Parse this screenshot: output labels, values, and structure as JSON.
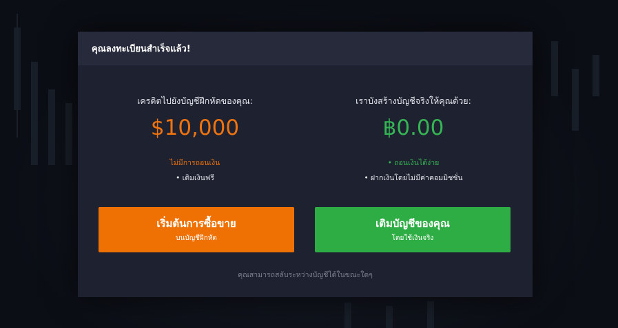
{
  "modal": {
    "title": "คุณลงทะเบียนสำเร็จแล้ว!",
    "demo": {
      "label": "เครดิตไปยังบัญชีฝึกหัดของคุณ:",
      "amount": "$10,000",
      "note_colored": "ไม่มีการถอนเงิน",
      "note_white": "• เติมเงินฟรี"
    },
    "real": {
      "label": "เราบังสร้างบัญชีจริงให้คุณด้วย:",
      "amount": "฿0.00",
      "note_colored": "• ถอนเงินได้ง่าย",
      "note_white": "• ฝากเงินโดยไม่มีค่าคอมมิชชั่น"
    },
    "buttons": {
      "start_trading": {
        "main": "เริ่มต้นการซื้อขาย",
        "sub": "บนบัญชีฝึกหัด"
      },
      "deposit": {
        "main": "เติมบัญชีของคุณ",
        "sub": "โดยใช้เงินจริง"
      }
    },
    "footer_note": "คุณสามารถสลับระหว่างบัญชีได้ในขณะใดๆ"
  },
  "colors": {
    "orange": "#ef7103",
    "green": "#2ead45",
    "modal_bg": "#1e2130",
    "header_bg": "#262a3a"
  }
}
